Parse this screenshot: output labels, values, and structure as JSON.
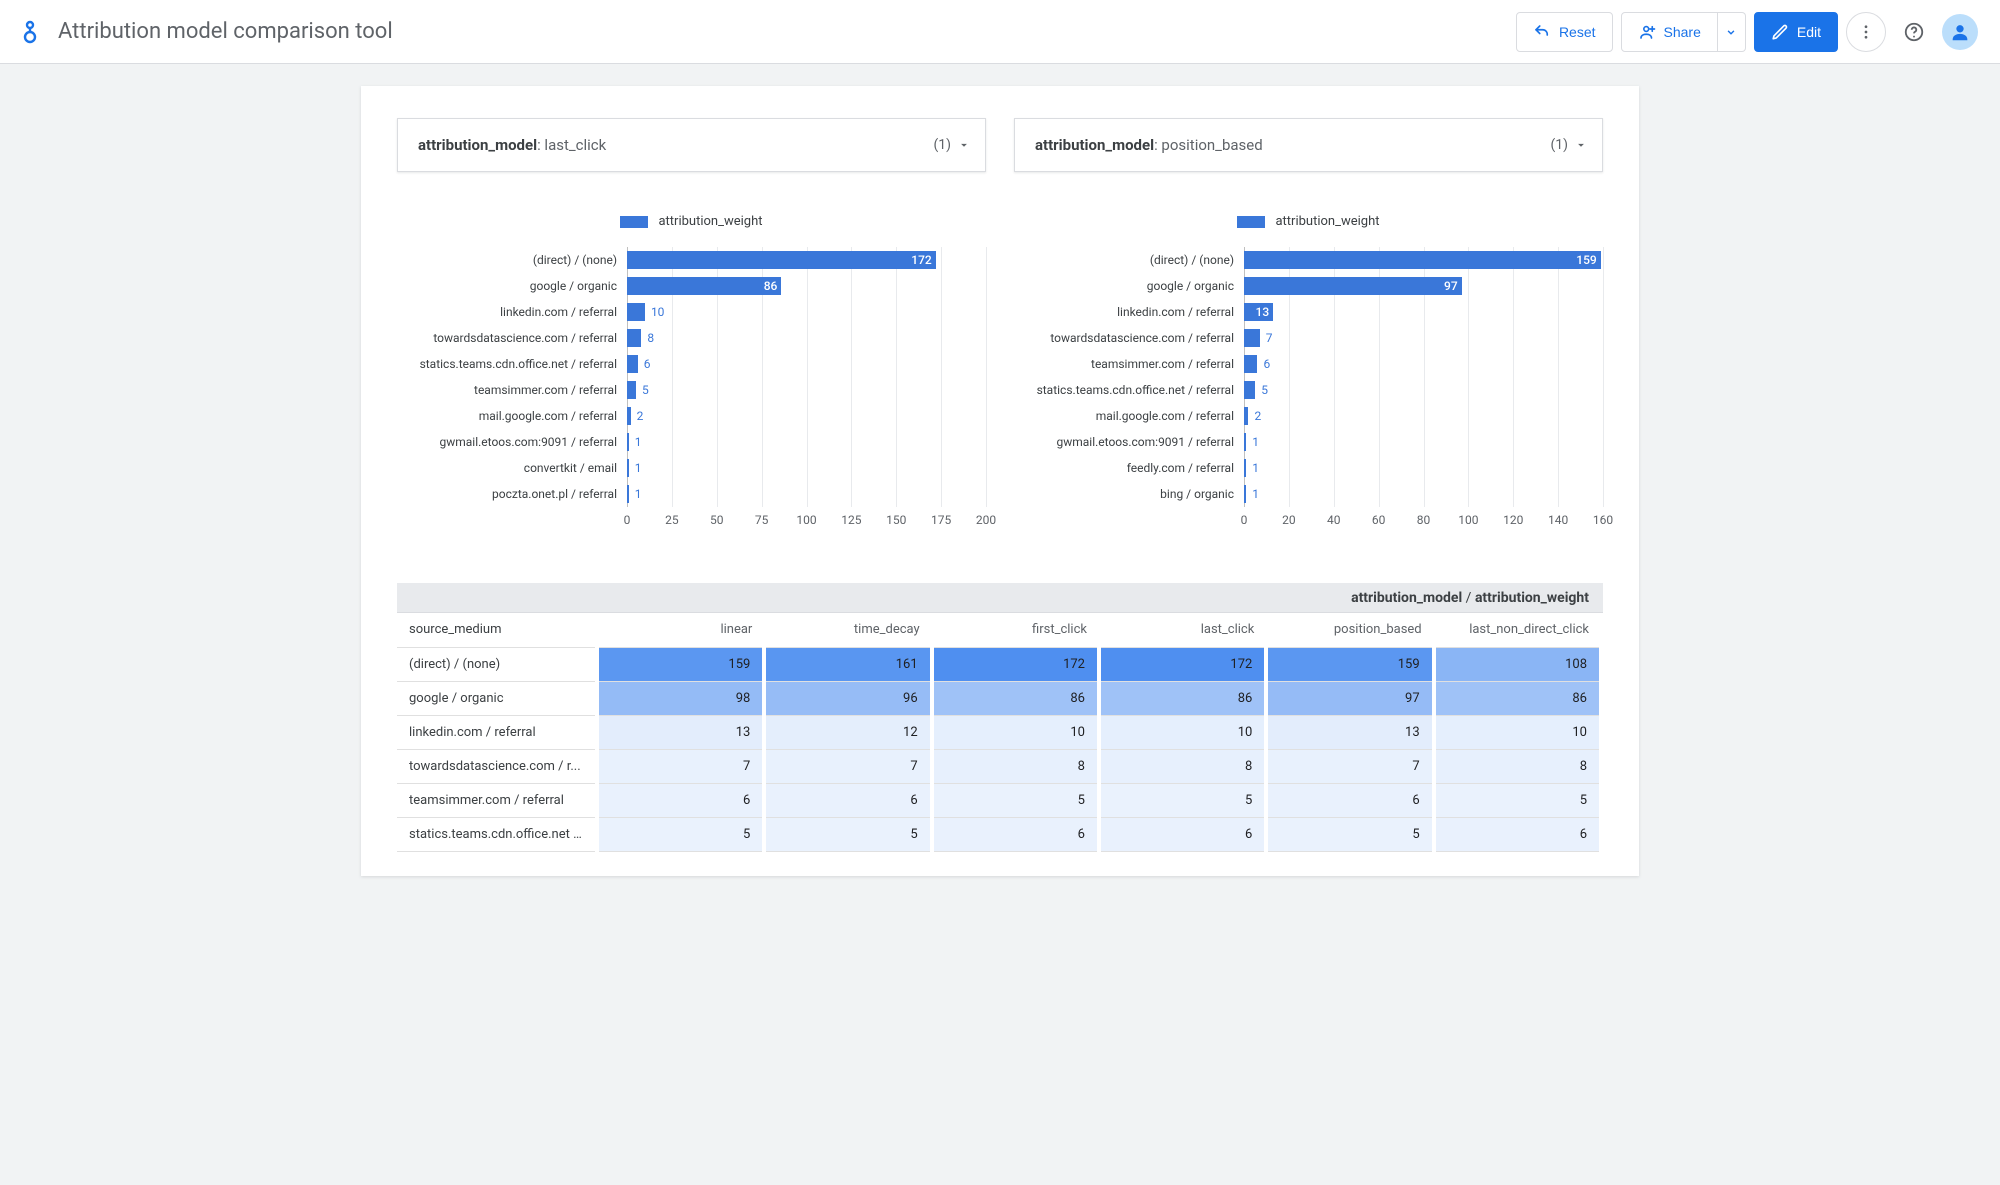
{
  "header": {
    "title": "Attribution model comparison tool",
    "reset_label": "Reset",
    "share_label": "Share",
    "edit_label": "Edit"
  },
  "filters": {
    "key": "attribution_model",
    "left_value": "last_click",
    "right_value": "position_based",
    "count_label": "(1)"
  },
  "legend": {
    "label": "attribution_weight"
  },
  "chart_data": [
    {
      "type": "bar",
      "orientation": "horizontal",
      "title": "",
      "series_name": "attribution_weight",
      "categories": [
        "(direct) / (none)",
        "google / organic",
        "linkedin.com / referral",
        "towardsdatascience.com / referral",
        "statics.teams.cdn.office.net / referral",
        "teamsimmer.com / referral",
        "mail.google.com / referral",
        "gwmail.etoos.com:9091 / referral",
        "convertkit / email",
        "poczta.onet.pl / referral"
      ],
      "values": [
        172,
        86,
        10,
        8,
        6,
        5,
        2,
        1,
        1,
        1
      ],
      "xlim": [
        0,
        200
      ],
      "xticks": [
        0,
        25,
        50,
        75,
        100,
        125,
        150,
        175,
        200
      ]
    },
    {
      "type": "bar",
      "orientation": "horizontal",
      "title": "",
      "series_name": "attribution_weight",
      "categories": [
        "(direct) / (none)",
        "google / organic",
        "linkedin.com / referral",
        "towardsdatascience.com / referral",
        "teamsimmer.com / referral",
        "statics.teams.cdn.office.net / referral",
        "mail.google.com / referral",
        "gwmail.etoos.com:9091 / referral",
        "feedly.com / referral",
        "bing / organic"
      ],
      "values": [
        159,
        97,
        13,
        7,
        6,
        5,
        2,
        1,
        1,
        1
      ],
      "xlim": [
        0,
        160
      ],
      "xticks": [
        0,
        20,
        40,
        60,
        80,
        100,
        120,
        140,
        160
      ]
    }
  ],
  "table": {
    "super_head_a": "attribution_model",
    "super_head_b": "attribution_weight",
    "row_header": "source_medium",
    "columns": [
      "linear",
      "time_decay",
      "first_click",
      "last_click",
      "position_based",
      "last_non_direct_click"
    ],
    "rows": [
      {
        "label": "(direct) / (none)",
        "vals": [
          159,
          161,
          172,
          172,
          159,
          108
        ]
      },
      {
        "label": "google / organic",
        "vals": [
          98,
          96,
          86,
          86,
          97,
          86
        ]
      },
      {
        "label": "linkedin.com / referral",
        "vals": [
          13,
          12,
          10,
          10,
          13,
          10
        ]
      },
      {
        "label": "towardsdatascience.com / r...",
        "vals": [
          7,
          7,
          8,
          8,
          7,
          8
        ]
      },
      {
        "label": "teamsimmer.com / referral",
        "vals": [
          6,
          6,
          5,
          5,
          6,
          5
        ]
      },
      {
        "label": "statics.teams.cdn.office.net ...",
        "vals": [
          5,
          5,
          6,
          6,
          5,
          6
        ]
      }
    ],
    "column_max": 172,
    "column_min": 5
  },
  "colors": {
    "bar": "#3a77d9",
    "heat_hi": "#4f8ff0",
    "heat_mid": "#9fc3f5",
    "heat_lo": "#eaf2fd"
  }
}
